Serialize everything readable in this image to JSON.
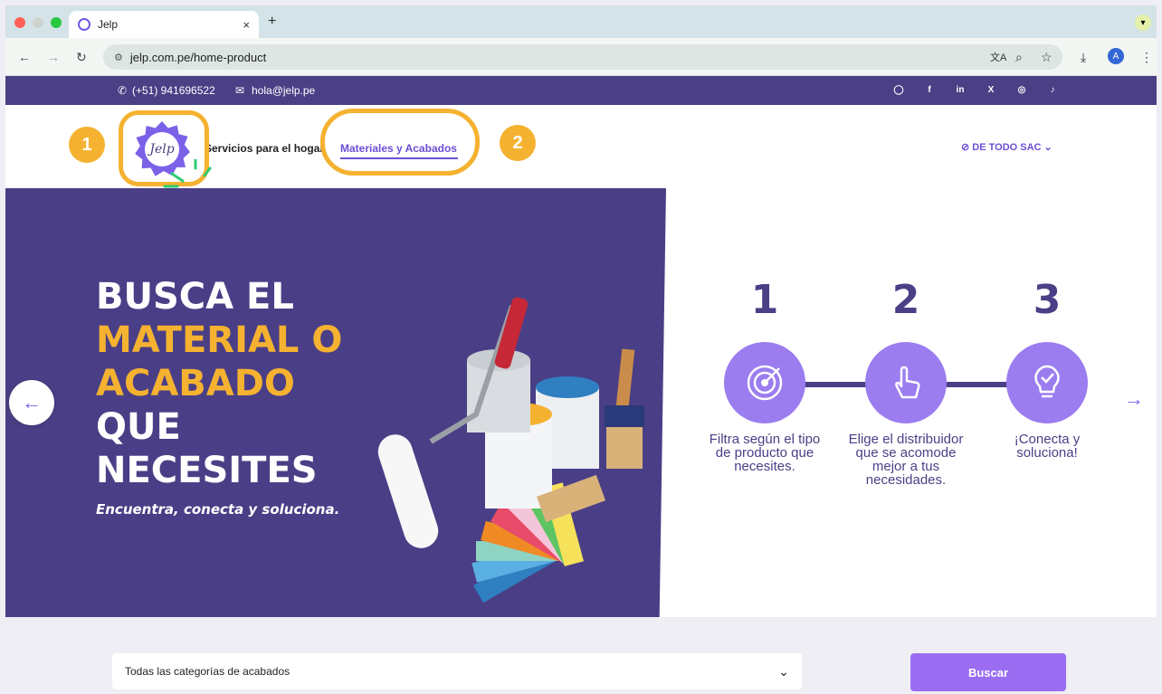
{
  "browser": {
    "tab_title": "Jelp",
    "tab_close": "×",
    "new_tab": "+",
    "url": "jelp.com.pe/home-product",
    "profile_initial": "A"
  },
  "topbar": {
    "phone": "(+51) 941696522",
    "email": "hola@jelp.pe",
    "social_icons": [
      "whatsapp-icon",
      "facebook-icon",
      "linkedin-icon",
      "x-icon",
      "instagram-icon",
      "tiktok-icon"
    ]
  },
  "header": {
    "logo_text": "Jelp",
    "nav": [
      {
        "label": "Servicios para el hogar",
        "active": false
      },
      {
        "label": "Materiales y Acabados",
        "active": true
      }
    ],
    "company": "DE TODO SAC"
  },
  "annotations": {
    "badge_1": "1",
    "badge_2": "2",
    "highlight_color": "#f5b230",
    "cursor_color": "#2ecc71"
  },
  "hero": {
    "headline_1": "BUSCA EL",
    "headline_2": "MATERIAL O",
    "headline_3": "ACABADO",
    "headline_4": "QUE",
    "headline_5": "NECESITES",
    "tagline": "Encuentra, conecta y soluciona.",
    "steps": [
      {
        "num": "1",
        "icon": "target-icon",
        "text": "Filtra según el tipo de producto que necesites."
      },
      {
        "num": "2",
        "icon": "tap-hand-icon",
        "text": "Elige el distribuidor que se acomode mejor a tus necesidades."
      },
      {
        "num": "3",
        "icon": "lightbulb-check-icon",
        "text": "¡Conecta y soluciona!"
      }
    ]
  },
  "search": {
    "category_select": "Todas las categorías de acabados",
    "button": "Buscar"
  },
  "colors": {
    "brand_purple": "#4b3f86",
    "accent_purple": "#9b6df2",
    "accent_yellow": "#f5b230"
  }
}
